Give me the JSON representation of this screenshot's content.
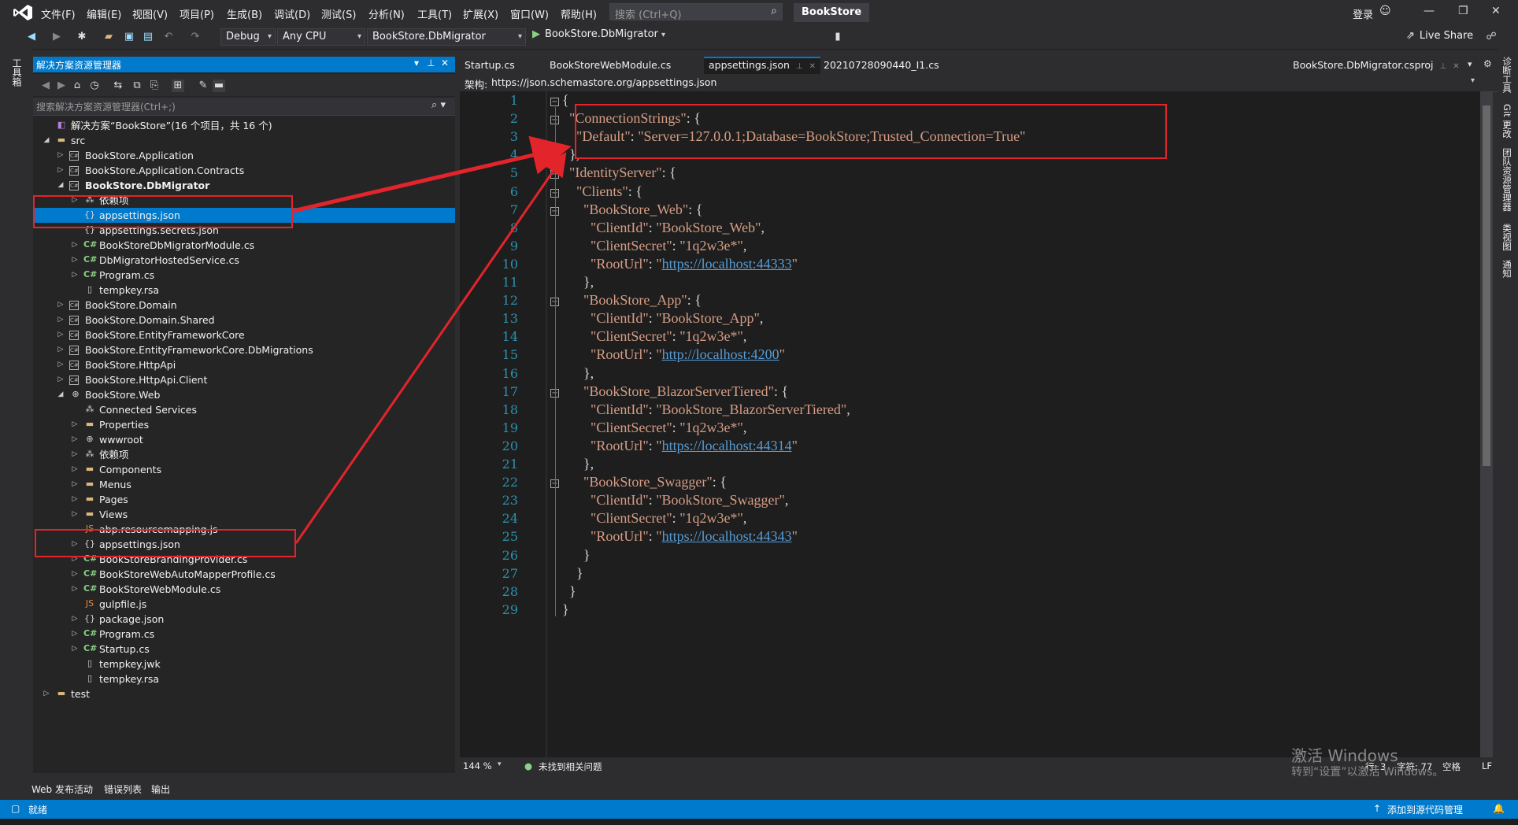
{
  "menubar": {
    "items": [
      "文件(F)",
      "编辑(E)",
      "视图(V)",
      "项目(P)",
      "生成(B)",
      "调试(D)",
      "测试(S)",
      "分析(N)",
      "工具(T)",
      "扩展(X)",
      "窗口(W)",
      "帮助(H)"
    ],
    "search_placeholder": "搜索 (Ctrl+Q)",
    "app_title": "BookStore",
    "login": "登录"
  },
  "toolbar": {
    "config": "Debug",
    "platform": "Any CPU",
    "startup_project": "BookStore.DbMigrator",
    "run_target": "BookStore.DbMigrator",
    "live_share": "Live Share"
  },
  "left_strip": {
    "label": "工具箱"
  },
  "solution_explorer": {
    "title": "解决方案资源管理器",
    "search_placeholder": "搜索解决方案资源管理器(Ctrl+;)",
    "tree": [
      {
        "label": "解决方案“BookStore”(16 个项目，共 16 个)",
        "icon": "sln",
        "indent": 0,
        "exp": ""
      },
      {
        "label": "src",
        "icon": "folder",
        "indent": 0,
        "exp": "open"
      },
      {
        "label": "BookStore.Application",
        "icon": "proj",
        "indent": 1,
        "exp": "closed"
      },
      {
        "label": "BookStore.Application.Contracts",
        "icon": "proj",
        "indent": 1,
        "exp": "closed"
      },
      {
        "label": "BookStore.DbMigrator",
        "icon": "proj",
        "indent": 1,
        "exp": "open",
        "bold": true
      },
      {
        "label": "依赖项",
        "icon": "ref",
        "indent": 2,
        "exp": "closed"
      },
      {
        "label": "appsettings.json",
        "icon": "json",
        "indent": 2,
        "exp": "",
        "selected": true
      },
      {
        "label": "appsettings.secrets.json",
        "icon": "json",
        "indent": 2,
        "exp": ""
      },
      {
        "label": "BookStoreDbMigratorModule.cs",
        "icon": "cs",
        "indent": 2,
        "exp": "closed"
      },
      {
        "label": "DbMigratorHostedService.cs",
        "icon": "cs",
        "indent": 2,
        "exp": "closed"
      },
      {
        "label": "Program.cs",
        "icon": "cs",
        "indent": 2,
        "exp": "closed"
      },
      {
        "label": "tempkey.rsa",
        "icon": "file",
        "indent": 2,
        "exp": ""
      },
      {
        "label": "BookStore.Domain",
        "icon": "proj",
        "indent": 1,
        "exp": "closed"
      },
      {
        "label": "BookStore.Domain.Shared",
        "icon": "proj",
        "indent": 1,
        "exp": "closed"
      },
      {
        "label": "BookStore.EntityFrameworkCore",
        "icon": "proj",
        "indent": 1,
        "exp": "closed"
      },
      {
        "label": "BookStore.EntityFrameworkCore.DbMigrations",
        "icon": "proj",
        "indent": 1,
        "exp": "closed"
      },
      {
        "label": "BookStore.HttpApi",
        "icon": "proj",
        "indent": 1,
        "exp": "closed"
      },
      {
        "label": "BookStore.HttpApi.Client",
        "icon": "proj",
        "indent": 1,
        "exp": "closed"
      },
      {
        "label": "BookStore.Web",
        "icon": "web",
        "indent": 1,
        "exp": "open"
      },
      {
        "label": "Connected Services",
        "icon": "ref",
        "indent": 2,
        "exp": ""
      },
      {
        "label": "Properties",
        "icon": "folder",
        "indent": 2,
        "exp": "closed"
      },
      {
        "label": "wwwroot",
        "icon": "web",
        "indent": 2,
        "exp": "closed"
      },
      {
        "label": "依赖项",
        "icon": "ref",
        "indent": 2,
        "exp": "closed"
      },
      {
        "label": "Components",
        "icon": "folder",
        "indent": 2,
        "exp": "closed"
      },
      {
        "label": "Menus",
        "icon": "folder",
        "indent": 2,
        "exp": "closed"
      },
      {
        "label": "Pages",
        "icon": "folder",
        "indent": 2,
        "exp": "closed"
      },
      {
        "label": "Views",
        "icon": "folder",
        "indent": 2,
        "exp": "closed"
      },
      {
        "label": "abp.resourcemapping.js",
        "icon": "js",
        "indent": 2,
        "exp": ""
      },
      {
        "label": "appsettings.json",
        "icon": "json",
        "indent": 2,
        "exp": "closed"
      },
      {
        "label": "BookStoreBrandingProvider.cs",
        "icon": "cs",
        "indent": 2,
        "exp": "closed"
      },
      {
        "label": "BookStoreWebAutoMapperProfile.cs",
        "icon": "cs",
        "indent": 2,
        "exp": "closed"
      },
      {
        "label": "BookStoreWebModule.cs",
        "icon": "cs",
        "indent": 2,
        "exp": "closed"
      },
      {
        "label": "gulpfile.js",
        "icon": "js",
        "indent": 2,
        "exp": ""
      },
      {
        "label": "package.json",
        "icon": "json",
        "indent": 2,
        "exp": "closed"
      },
      {
        "label": "Program.cs",
        "icon": "cs",
        "indent": 2,
        "exp": "closed"
      },
      {
        "label": "Startup.cs",
        "icon": "cs",
        "indent": 2,
        "exp": "closed"
      },
      {
        "label": "tempkey.jwk",
        "icon": "file",
        "indent": 2,
        "exp": ""
      },
      {
        "label": "tempkey.rsa",
        "icon": "file",
        "indent": 2,
        "exp": ""
      },
      {
        "label": "test",
        "icon": "folder",
        "indent": 0,
        "exp": "closed"
      }
    ]
  },
  "doc_tabs": {
    "items": [
      "Startup.cs",
      "BookStoreWebModule.cs",
      "appsettings.json",
      "20210728090440_I1.cs"
    ],
    "active_index": 2,
    "right_tab": "BookStore.DbMigrator.csproj"
  },
  "schema": {
    "label": "架构:",
    "url": "https://json.schemastore.org/appsettings.json"
  },
  "editor": {
    "lines": [
      [
        [
          "p",
          "{"
        ]
      ],
      [
        [
          "p",
          "  "
        ],
        [
          "k",
          "\"ConnectionStrings\""
        ],
        [
          "p",
          ": {"
        ]
      ],
      [
        [
          "p",
          "    "
        ],
        [
          "k",
          "\"Default\""
        ],
        [
          "p",
          ": "
        ],
        [
          "k",
          "\"Server=127.0.0.1;Database=BookStore;Trusted_Connection=True\""
        ]
      ],
      [
        [
          "p",
          "  },"
        ]
      ],
      [
        [
          "p",
          "  "
        ],
        [
          "k",
          "\"IdentityServer\""
        ],
        [
          "p",
          ": {"
        ]
      ],
      [
        [
          "p",
          "    "
        ],
        [
          "k",
          "\"Clients\""
        ],
        [
          "p",
          ": {"
        ]
      ],
      [
        [
          "p",
          "      "
        ],
        [
          "k",
          "\"BookStore_Web\""
        ],
        [
          "p",
          ": {"
        ]
      ],
      [
        [
          "p",
          "        "
        ],
        [
          "k",
          "\"ClientId\""
        ],
        [
          "p",
          ": "
        ],
        [
          "k",
          "\"BookStore_Web\""
        ],
        [
          "p",
          ","
        ]
      ],
      [
        [
          "p",
          "        "
        ],
        [
          "k",
          "\"ClientSecret\""
        ],
        [
          "p",
          ": "
        ],
        [
          "k",
          "\"1q2w3e*\""
        ],
        [
          "p",
          ","
        ]
      ],
      [
        [
          "p",
          "        "
        ],
        [
          "k",
          "\"RootUrl\""
        ],
        [
          "p",
          ": "
        ],
        [
          "k",
          "\""
        ],
        [
          "u",
          "https://localhost:44333"
        ],
        [
          "k",
          "\""
        ]
      ],
      [
        [
          "p",
          "      },"
        ]
      ],
      [
        [
          "p",
          "      "
        ],
        [
          "k",
          "\"BookStore_App\""
        ],
        [
          "p",
          ": {"
        ]
      ],
      [
        [
          "p",
          "        "
        ],
        [
          "k",
          "\"ClientId\""
        ],
        [
          "p",
          ": "
        ],
        [
          "k",
          "\"BookStore_App\""
        ],
        [
          "p",
          ","
        ]
      ],
      [
        [
          "p",
          "        "
        ],
        [
          "k",
          "\"ClientSecret\""
        ],
        [
          "p",
          ": "
        ],
        [
          "k",
          "\"1q2w3e*\""
        ],
        [
          "p",
          ","
        ]
      ],
      [
        [
          "p",
          "        "
        ],
        [
          "k",
          "\"RootUrl\""
        ],
        [
          "p",
          ": "
        ],
        [
          "k",
          "\""
        ],
        [
          "u",
          "http://localhost:4200"
        ],
        [
          "k",
          "\""
        ]
      ],
      [
        [
          "p",
          "      },"
        ]
      ],
      [
        [
          "p",
          "      "
        ],
        [
          "k",
          "\"BookStore_BlazorServerTiered\""
        ],
        [
          "p",
          ": {"
        ]
      ],
      [
        [
          "p",
          "        "
        ],
        [
          "k",
          "\"ClientId\""
        ],
        [
          "p",
          ": "
        ],
        [
          "k",
          "\"BookStore_BlazorServerTiered\""
        ],
        [
          "p",
          ","
        ]
      ],
      [
        [
          "p",
          "        "
        ],
        [
          "k",
          "\"ClientSecret\""
        ],
        [
          "p",
          ": "
        ],
        [
          "k",
          "\"1q2w3e*\""
        ],
        [
          "p",
          ","
        ]
      ],
      [
        [
          "p",
          "        "
        ],
        [
          "k",
          "\"RootUrl\""
        ],
        [
          "p",
          ": "
        ],
        [
          "k",
          "\""
        ],
        [
          "u",
          "https://localhost:44314"
        ],
        [
          "k",
          "\""
        ]
      ],
      [
        [
          "p",
          "      },"
        ]
      ],
      [
        [
          "p",
          "      "
        ],
        [
          "k",
          "\"BookStore_Swagger\""
        ],
        [
          "p",
          ": {"
        ]
      ],
      [
        [
          "p",
          "        "
        ],
        [
          "k",
          "\"ClientId\""
        ],
        [
          "p",
          ": "
        ],
        [
          "k",
          "\"BookStore_Swagger\""
        ],
        [
          "p",
          ","
        ]
      ],
      [
        [
          "p",
          "        "
        ],
        [
          "k",
          "\"ClientSecret\""
        ],
        [
          "p",
          ": "
        ],
        [
          "k",
          "\"1q2w3e*\""
        ],
        [
          "p",
          ","
        ]
      ],
      [
        [
          "p",
          "        "
        ],
        [
          "k",
          "\"RootUrl\""
        ],
        [
          "p",
          ": "
        ],
        [
          "k",
          "\""
        ],
        [
          "u",
          "https://localhost:44343"
        ],
        [
          "k",
          "\""
        ]
      ],
      [
        [
          "p",
          "      }"
        ]
      ],
      [
        [
          "p",
          "    }"
        ]
      ],
      [
        [
          "p",
          "  }"
        ]
      ],
      [
        [
          "p",
          "}"
        ]
      ]
    ],
    "fold_lines": [
      1,
      2,
      5,
      6,
      7,
      12,
      17,
      22
    ]
  },
  "editor_status": {
    "zoom": "144 %",
    "issues": "未找到相关问题",
    "line": "行: 3",
    "char": "字符: 77",
    "spaces": "空格",
    "eol": "LF"
  },
  "right_strip": {
    "labels": [
      "诊断工具",
      "Git 更改",
      "团队资源管理器",
      "类视图",
      "通知"
    ]
  },
  "bottom_tabs": [
    "Web 发布活动",
    "错误列表",
    "输出"
  ],
  "status": {
    "ready": "就绪",
    "add_source": "添加到源代码管理"
  },
  "watermark": {
    "line1": "激活 Windows",
    "line2": "转到“设置”以激活 Windows。"
  },
  "colors": {
    "accent": "#007acc",
    "annotation": "#e3242b",
    "string": "#d69d85",
    "link": "#569cd6"
  }
}
